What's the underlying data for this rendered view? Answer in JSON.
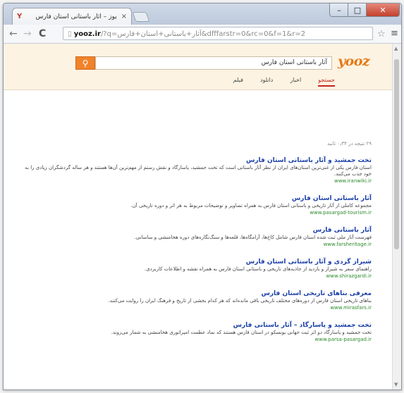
{
  "browser": {
    "tab_title": "یوز – آثار باستانی استان فارس",
    "tab_favicon": "Y",
    "url_host": "yooz.ir",
    "url_rest": "/?q=آثار+باستانی+استان+فارس&dfffarstr=0&rc=0&f=1&r=2",
    "back": "←",
    "forward": "→",
    "reload": "C",
    "star": "☆",
    "menu": "≡",
    "win_min": "–",
    "win_max": "□",
    "win_close": "✕"
  },
  "header": {
    "logo": "yooz",
    "search_query": "آثار باستانی استان فارس",
    "search_button_icon": "search-icon",
    "categories": [
      "جستجو",
      "اخبار",
      "دانلود",
      "فیلم"
    ],
    "accent_color": "#f0832a"
  },
  "results_info": "۲۹ نتیجه در ۰٫۳۴ ثانیه",
  "results": [
    {
      "title": "تخت جمشید و آثار باستانی استان فارس",
      "snippet": "استان فارس یکی از غنی‌ترین استان‌های ایران از نظر آثار باستانی است که تخت جمشید، پاسارگاد و نقش رستم از مهم‌ترین آن‌ها هستند و هر ساله گردشگران زیادی را به خود جذب می‌کنند.",
      "url": "www.iranwiki.ir"
    },
    {
      "title": "آثار باستانی استان فارس",
      "snippet": "مجموعه کاملی از آثار تاریخی و باستانی استان فارس به همراه تصاویر و توضیحات مربوط به هر اثر و دوره تاریخی آن.",
      "url": "www.pasargad-tourism.ir"
    },
    {
      "title": "آثار باستانی فارس",
      "snippet": "فهرست آثار ملی ثبت شده استان فارس شامل کاخ‌ها، آرامگاه‌ها، قلعه‌ها و سنگ‌نگاره‌های دوره هخامنشی و ساسانی.",
      "url": "www.farsheritage.ir"
    },
    {
      "title": "شیراز گردی و آثار باستانی استان فارس",
      "snippet": "راهنمای سفر به شیراز و بازدید از جاذبه‌های تاریخی و باستانی استان فارس به همراه نقشه و اطلاعات کاربردی.",
      "url": "www.shirazgardi.ir"
    },
    {
      "title": "معرفی بناهای تاریخی استان فارس",
      "snippet": "بناهای تاریخی استان فارس از دوره‌های مختلف تاریخی باقی مانده‌اند که هر کدام بخشی از تاریخ و فرهنگ ایران را روایت می‌کنند.",
      "url": "www.mirasfars.ir"
    },
    {
      "title": "تخت جمشید و پاسارگاد – آثار باستانی فارس",
      "snippet": "تخت جمشید و پاسارگاد دو اثر ثبت جهانی یونسکو در استان فارس هستند که نماد عظمت امپراتوری هخامنشی به شمار می‌روند.",
      "url": "www.parsa-pasargad.ir"
    }
  ]
}
